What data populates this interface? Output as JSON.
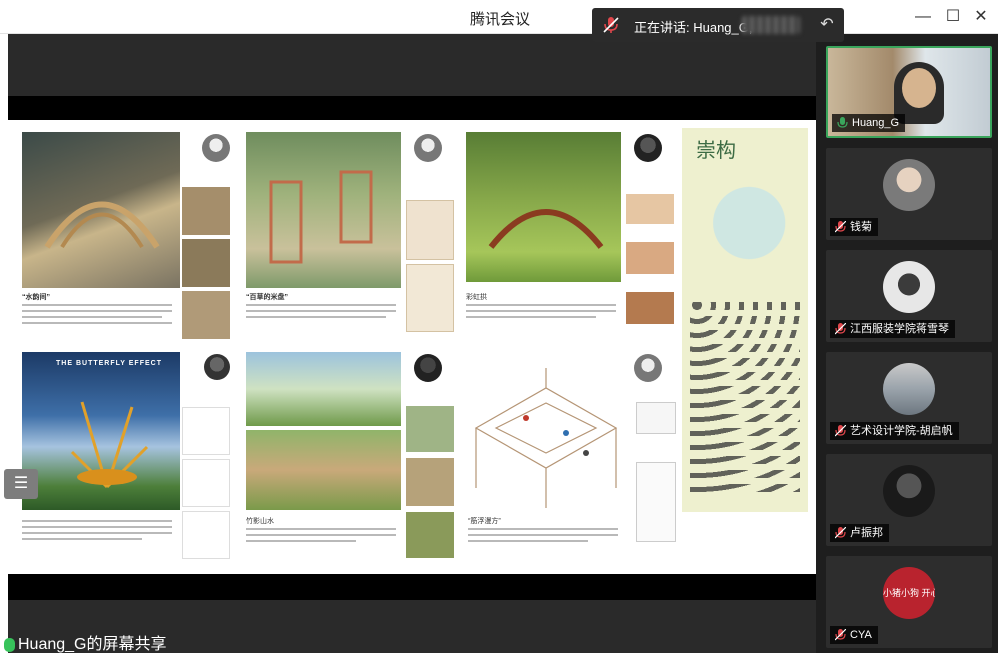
{
  "window": {
    "title": "腾讯会议",
    "minimize_icon": "minimize-icon",
    "maximize_icon": "maximize-icon",
    "close_icon": "close-icon"
  },
  "speaking_bar": {
    "text": "正在讲话: Huang_G;",
    "muted_mic_icon": "mic-muted-icon",
    "share_icon": "share-arrow-icon"
  },
  "share": {
    "sharer_label": "Huang_G的屏幕共享",
    "list_icon": "list-icon"
  },
  "slide": {
    "butterfly_title": "THE BUTTERFLY EFFECT",
    "captions": [
      "“水韵间”",
      "“百草的米盘”",
      "彩虹拱",
      "竹影山水",
      "“筋浮漫方”"
    ],
    "poster_title": "崇构"
  },
  "participants": [
    {
      "name": "Huang_G",
      "mic": "on",
      "speaking": true
    },
    {
      "name": "钱菊",
      "mic": "muted"
    },
    {
      "name": "江西服装学院蒋雪琴",
      "mic": "muted"
    },
    {
      "name": "艺术设计学院-胡启帆",
      "mic": "muted"
    },
    {
      "name": "卢振邦",
      "mic": "muted"
    },
    {
      "name": "CYA",
      "mic": "muted"
    }
  ],
  "avatar_text": {
    "cya": "小猪小狗 开心"
  },
  "colors": {
    "speaking_green": "#3aa55c",
    "muted_red": "#e0474c",
    "dark_bg": "#1e1e1e"
  }
}
